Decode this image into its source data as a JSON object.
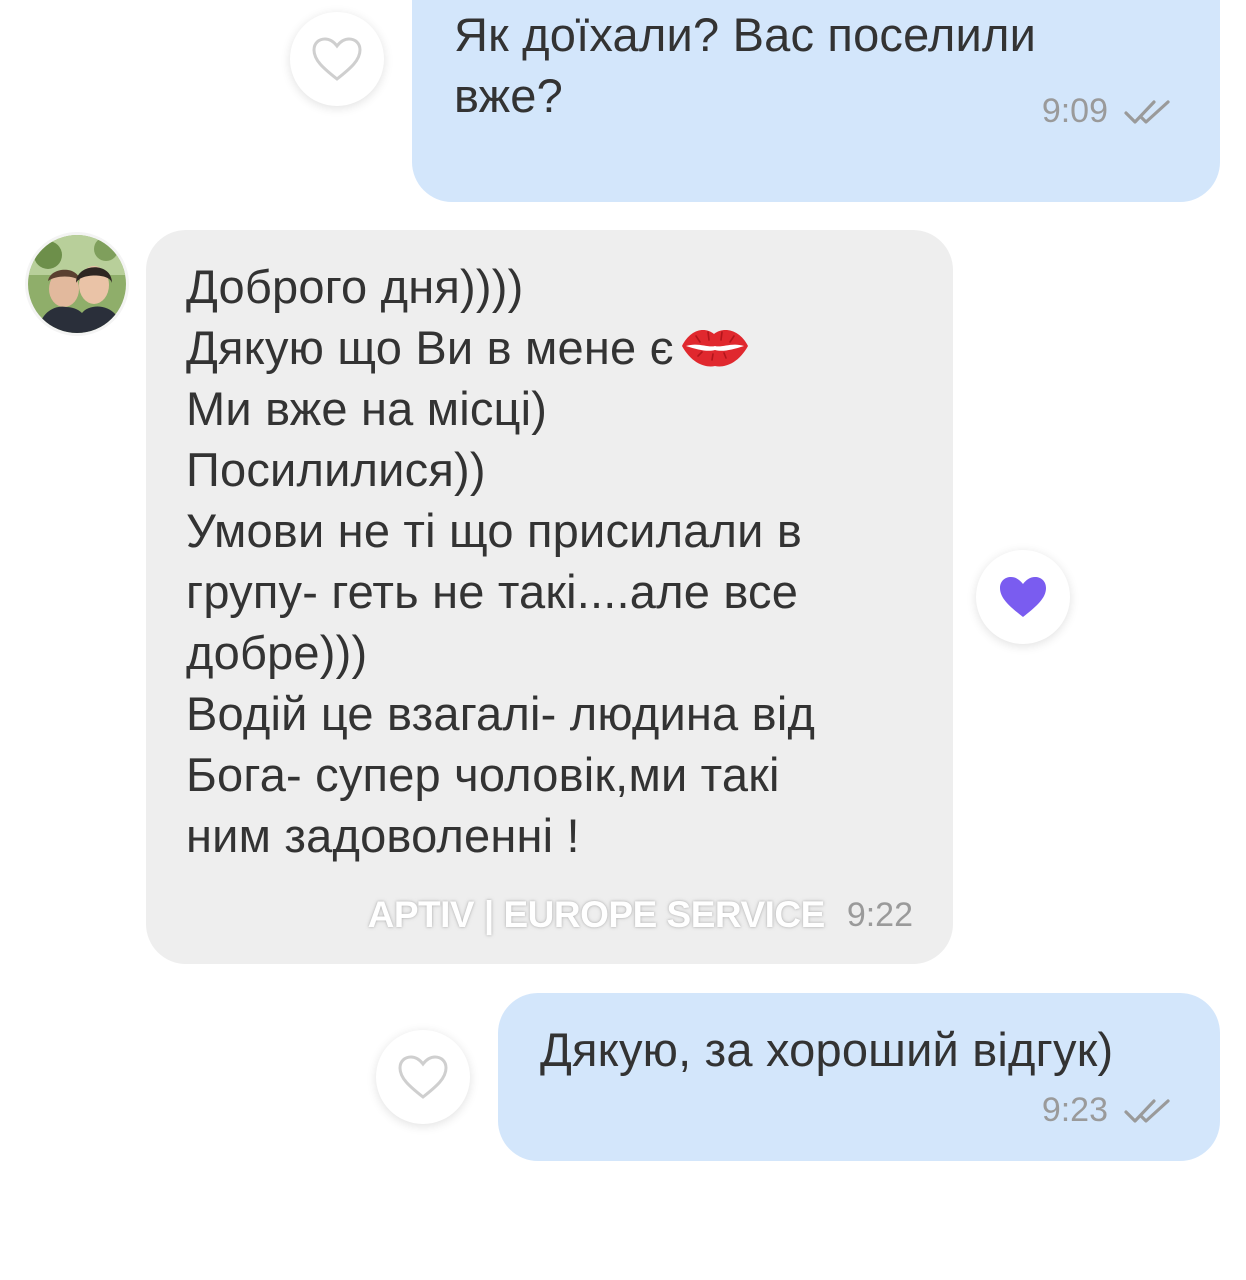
{
  "messages": [
    {
      "direction": "outgoing",
      "text": "Як доїхали?  Вас поселили\nвже?",
      "time": "9:09",
      "status_icon": "double-check-icon",
      "reaction": "heart-outline-icon"
    },
    {
      "direction": "incoming",
      "avatar": "contact-avatar",
      "text_before_emoji": "Доброго дня))))\nДякую що Ви в мене є",
      "emoji": "kiss-mark-icon",
      "text_after_emoji": "Ми вже на місці)\nПосилилися))\nУмови не ті що присилали в\nгрупу- геть не такі....але все\nдобре)))\nВодій це взагалі- людина від\nБога- супер чоловік,ми такі\nним задоволенні !",
      "watermark": "APTIV | EUROPE SERVICE",
      "time": "9:22",
      "reaction": "heart-filled-icon"
    },
    {
      "direction": "outgoing",
      "text": "Дякую, за хороший відгук)",
      "time": "9:23",
      "status_icon": "double-check-icon",
      "reaction": "heart-outline-icon"
    }
  ],
  "colors": {
    "outgoing_bubble": "#d3e6fb",
    "incoming_bubble": "#eeeeee",
    "reaction_filled": "#7a5cf0",
    "reaction_outline": "#cfcfcf",
    "meta_text": "#9a9a9a",
    "emoji_red": "#e0282e"
  }
}
